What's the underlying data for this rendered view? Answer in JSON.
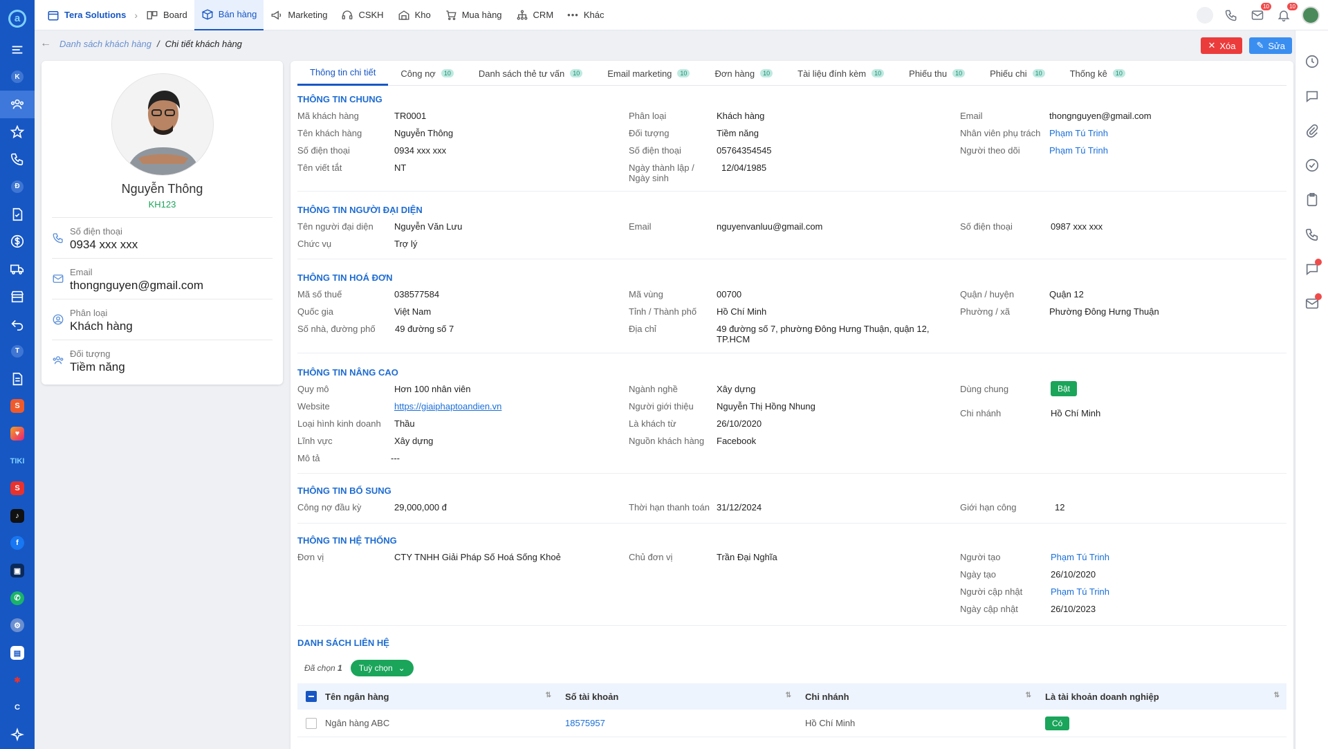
{
  "topbar": {
    "brand": "Tera Solutions",
    "nav": [
      "Board",
      "Bán hàng",
      "Marketing",
      "CSKH",
      "Kho",
      "Mua hàng",
      "CRM",
      "Khác"
    ],
    "active_nav": "Bán hàng",
    "mail_badge": "10",
    "bell_badge": "10"
  },
  "rail": {
    "letters": [
      "K",
      "Đ",
      "T",
      "C"
    ],
    "tiki": "TIKI"
  },
  "breadcrumb": {
    "parent": "Danh sách khách hàng",
    "separator": "/",
    "current": "Chi tiết khách hàng"
  },
  "actions": {
    "delete": "Xóa",
    "edit": "Sửa"
  },
  "profile": {
    "name": "Nguyễn Thông",
    "code": "KH123",
    "fields": [
      {
        "label": "Số điện thoại",
        "value": "0934 xxx xxx"
      },
      {
        "label": "Email",
        "value": "thongnguyen@gmail.com"
      },
      {
        "label": "Phân loại",
        "value": "Khách hàng"
      },
      {
        "label": "Đối tượng",
        "value": "Tiềm năng"
      }
    ]
  },
  "tabs": [
    {
      "label": "Thông tin chi tiết",
      "count": ""
    },
    {
      "label": "Công nợ",
      "count": "10"
    },
    {
      "label": "Danh sách thẻ tư vấn",
      "count": "10"
    },
    {
      "label": "Email marketing",
      "count": "10"
    },
    {
      "label": "Đơn hàng",
      "count": "10"
    },
    {
      "label": "Tài liệu đính kèm",
      "count": "10"
    },
    {
      "label": "Phiếu thu",
      "count": "10"
    },
    {
      "label": "Phiếu chi",
      "count": "10"
    },
    {
      "label": "Thống kê",
      "count": "10"
    }
  ],
  "general": {
    "title": "THÔNG TIN CHUNG",
    "ma_kh_label": "Mã khách hàng",
    "ma_kh": "TR0001",
    "ten_kh_label": "Tên khách hàng",
    "ten_kh": "Nguyễn Thông",
    "sdt_label": "Số điện thoại",
    "sdt": "0934 xxx xxx",
    "ten_vt_label": "Tên viết tắt",
    "ten_vt": "NT",
    "phan_loai_label": "Phân loại",
    "phan_loai": "Khách hàng",
    "doi_tuong_label": "Đối tượng",
    "doi_tuong": "Tiềm năng",
    "sdt2_label": "Số điện thoại",
    "sdt2": "05764354545",
    "ngay_tl_label": "Ngày thành lập /",
    "ngay_tl_label2": "Ngày sinh",
    "ngay_tl": "12/04/1985",
    "email_label": "Email",
    "email": "thongnguyen@gmail.com",
    "nv_label": "Nhân viên phụ trách",
    "nv": "Phạm Tú Trinh",
    "ntd_label": "Người theo dõi",
    "ntd": "Phạm Tú Trinh"
  },
  "representative": {
    "title": "THÔNG TIN NGƯỜI ĐẠI DIỆN",
    "ten_label": "Tên người đại diện",
    "ten": "Nguyễn Văn Lưu",
    "chuc_vu_label": "Chức vụ",
    "chuc_vu": "Trợ lý",
    "email_label": "Email",
    "email": "nguyenvanluu@gmail.com",
    "sdt_label": "Số điện thoại",
    "sdt": "0987 xxx xxx"
  },
  "invoice": {
    "title": "THÔNG TIN HOÁ ĐƠN",
    "mst_label": "Mã số thuế",
    "mst": "038577584",
    "qg_label": "Quốc gia",
    "qg": "Việt Nam",
    "sn_label": "Số nhà, đường phố",
    "sn": "49 đường số 7",
    "mv_label": "Mã vùng",
    "mv": "00700",
    "tinh_label": "Tỉnh / Thành phố",
    "tinh": "Hồ Chí Minh",
    "dc_label": "Địa chỉ",
    "dc1": "49 đường số 7, phường Đông Hưng Thuận, quận 12,",
    "dc2": "TP.HCM",
    "quan_label": "Quận / huyện",
    "quan": "Quận 12",
    "phuong_label": "Phường / xã",
    "phuong": "Phường Đông Hưng Thuận"
  },
  "advanced": {
    "title": "THÔNG TIN NÂNG CAO",
    "qm_label": "Quy mô",
    "qm": "Hơn 100 nhân viên",
    "web_label": "Website",
    "web": "https://giaiphaptoandien.vn",
    "lh_label": "Loại hình kinh doanh",
    "lh": "Thầu",
    "lv_label": "Lĩnh vực",
    "lv": "Xây dựng",
    "mt_label": "Mô tả",
    "mt": "---",
    "nn_label": "Ngành nghề",
    "nn": "Xây dựng",
    "ngt_label": "Người giới thiệu",
    "ngt": "Nguyễn Thị Hồng Nhung",
    "lkt_label": "Là khách từ",
    "lkt": "26/10/2020",
    "nguon_label": "Nguồn khách hàng",
    "nguon": "Facebook",
    "dc_label": "Dùng chung",
    "dc": "Bật",
    "cn_label": "Chi nhánh",
    "cn": "Hồ Chí Minh"
  },
  "additional": {
    "title": "THÔNG TIN BỔ SUNG",
    "cn_label": "Công nợ đầu kỳ",
    "cn": "29,000,000 đ",
    "th_label": "Thời hạn thanh toán",
    "th": "31/12/2024",
    "gh_label": "Giới hạn công",
    "gh": "12"
  },
  "system": {
    "title": "THÔNG TIN HỆ THỐNG",
    "dv_label": "Đơn vị",
    "dv": "CTY TNHH Giải Pháp Số Hoá Sống Khoẻ",
    "cdv_label": "Chủ đơn vị",
    "cdv": "Trần Đại Nghĩa",
    "nt_label": "Người tạo",
    "nt": "Phạm Tú Trinh",
    "ngt_label": "Ngày tạo",
    "ngt": "26/10/2020",
    "ncn_label": "Người cập nhật",
    "ncn": "Phạm Tú Trinh",
    "ngcn_label": "Ngày cập nhật",
    "ngcn": "26/10/2023"
  },
  "contacts": {
    "title": "DANH SÁCH LIÊN HỆ",
    "selected_label": "Đã chọn",
    "selected_count": "1",
    "options": "Tuỳ chọn",
    "columns": [
      "Tên ngân hàng",
      "Số tài khoản",
      "Chi nhánh",
      "Là tài khoản doanh nghiệp"
    ],
    "rows": [
      {
        "bank": "Ngân hàng ABC",
        "account": "18575957",
        "branch": "Hồ Chí Minh",
        "business": "Có"
      }
    ]
  },
  "colors": {
    "primary": "#1757c4",
    "accent_green": "#1aa55a",
    "danger": "#ec3b3b",
    "section_title": "#1e6cd2"
  }
}
